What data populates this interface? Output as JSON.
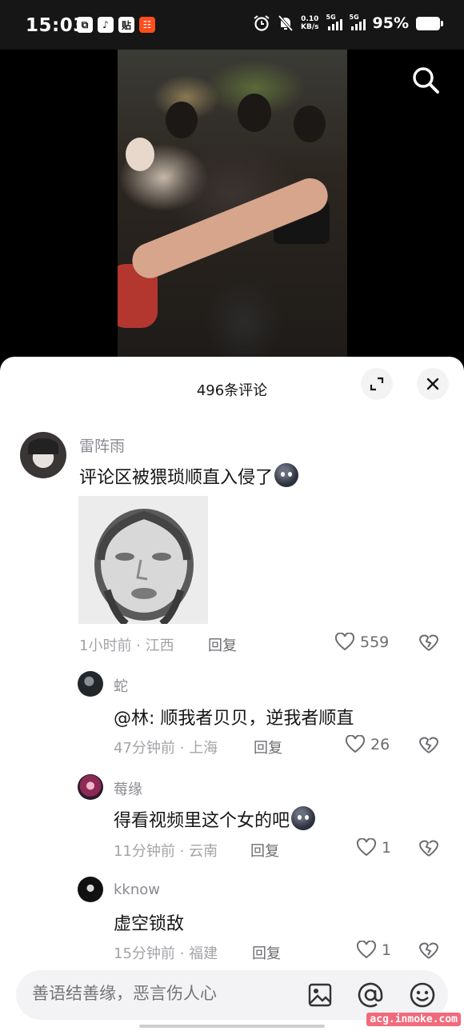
{
  "status_bar": {
    "time": "15:03",
    "app_icons": [
      "⧉",
      "♪",
      "贴",
      "☷"
    ],
    "net_speed": "0.10",
    "net_unit": "KB/s",
    "sim1": "5G",
    "sim2": "5G",
    "battery": "95%"
  },
  "panel": {
    "title": "496条评论"
  },
  "comments": [
    {
      "user": "雷阵雨",
      "text": "评论区被猥琐顺直入侵了",
      "time": "1小时前",
      "location": "江西",
      "reply": "回复",
      "likes": "559"
    },
    {
      "user": "蛇",
      "text": "@林: 顺我者贝贝，逆我者顺直",
      "time": "47分钟前",
      "location": "上海",
      "reply": "回复",
      "likes": "26"
    },
    {
      "user": "莓缘",
      "text": "得看视频里这个女的吧",
      "time": "11分钟前",
      "location": "云南",
      "reply": "回复",
      "likes": "1"
    },
    {
      "user": "kknow",
      "text": "虚空锁敌",
      "time": "15分钟前",
      "location": "福建",
      "reply": "回复",
      "likes": "1"
    }
  ],
  "input": {
    "placeholder": "善语结善缘，恶言伤人心"
  },
  "watermark": "acg.inmoke.com",
  "icons": {
    "search": "search-icon",
    "expand": "expand-icon",
    "close": "close-icon",
    "like": "heart-icon",
    "dislike": "broken-heart-icon",
    "image": "image-icon",
    "mention": "at-icon",
    "emoji": "smiley-icon"
  }
}
